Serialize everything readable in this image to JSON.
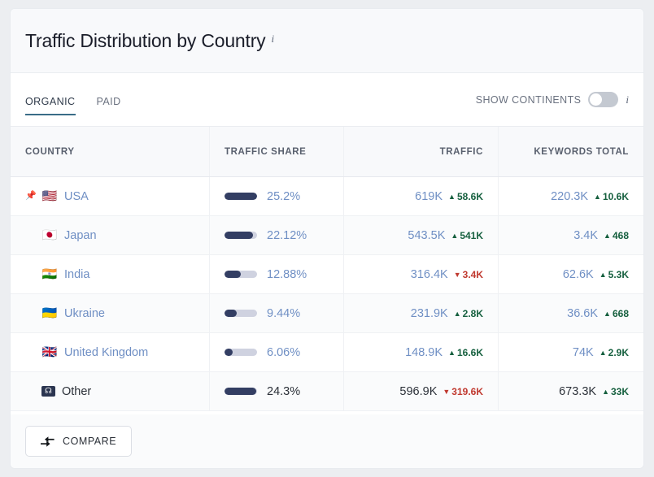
{
  "header": {
    "title": "Traffic Distribution by Country",
    "info_icon": "info-italic-i-icon"
  },
  "toolbar": {
    "tabs": [
      {
        "label": "ORGANIC",
        "active": true
      },
      {
        "label": "PAID",
        "active": false
      }
    ],
    "show_continents_label": "SHOW CONTINENTS",
    "toggle_state": "off",
    "info_icon": "info-italic-i-icon"
  },
  "table": {
    "columns": [
      "COUNTRY",
      "TRAFFIC SHARE",
      "TRAFFIC",
      "KEYWORDS TOTAL"
    ],
    "rows": [
      {
        "pinned": true,
        "pin_icon": "pushpin-icon",
        "flag": "🇺🇸",
        "flag_name": "flag-usa",
        "country": "USA",
        "share": "25.2%",
        "share_pct": 25.2,
        "traffic": "619K",
        "traffic_delta": "58.6K",
        "traffic_dir": "up",
        "keywords": "220.3K",
        "keywords_delta": "10.6K",
        "keywords_dir": "up"
      },
      {
        "pinned": false,
        "flag": "🇯🇵",
        "flag_name": "flag-japan",
        "country": "Japan",
        "share": "22.12%",
        "share_pct": 22.12,
        "traffic": "543.5K",
        "traffic_delta": "541K",
        "traffic_dir": "up",
        "keywords": "3.4K",
        "keywords_delta": "468",
        "keywords_dir": "up"
      },
      {
        "pinned": false,
        "flag": "🇮🇳",
        "flag_name": "flag-india",
        "country": "India",
        "share": "12.88%",
        "share_pct": 12.88,
        "traffic": "316.4K",
        "traffic_delta": "3.4K",
        "traffic_dir": "down",
        "keywords": "62.6K",
        "keywords_delta": "5.3K",
        "keywords_dir": "up"
      },
      {
        "pinned": false,
        "flag": "🇺🇦",
        "flag_name": "flag-ukraine",
        "country": "Ukraine",
        "share": "9.44%",
        "share_pct": 9.44,
        "traffic": "231.9K",
        "traffic_delta": "2.8K",
        "traffic_dir": "up",
        "keywords": "36.6K",
        "keywords_delta": "668",
        "keywords_dir": "up"
      },
      {
        "pinned": false,
        "flag": "🇬🇧",
        "flag_name": "flag-united-kingdom",
        "country": "United Kingdom",
        "share": "6.06%",
        "share_pct": 6.06,
        "traffic": "148.9K",
        "traffic_delta": "16.6K",
        "traffic_dir": "up",
        "keywords": "74K",
        "keywords_delta": "2.9K",
        "keywords_dir": "up"
      },
      {
        "pinned": false,
        "flag": "globe",
        "flag_name": "globe-icon",
        "country": "Other",
        "is_other": true,
        "share": "24.3%",
        "share_pct": 24.3,
        "traffic": "596.9K",
        "traffic_delta": "319.6K",
        "traffic_dir": "down",
        "keywords": "673.3K",
        "keywords_delta": "33K",
        "keywords_dir": "up"
      }
    ]
  },
  "footer": {
    "compare_label": "COMPARE",
    "compare_icon": "compare-arrows-icon"
  },
  "colors": {
    "link": "#6f8fc4",
    "up": "#16603f",
    "down": "#c0392f",
    "bar_fill": "#333e63",
    "bar_track": "#cfd2e0",
    "tab_active_underline": "#3a6d87"
  }
}
